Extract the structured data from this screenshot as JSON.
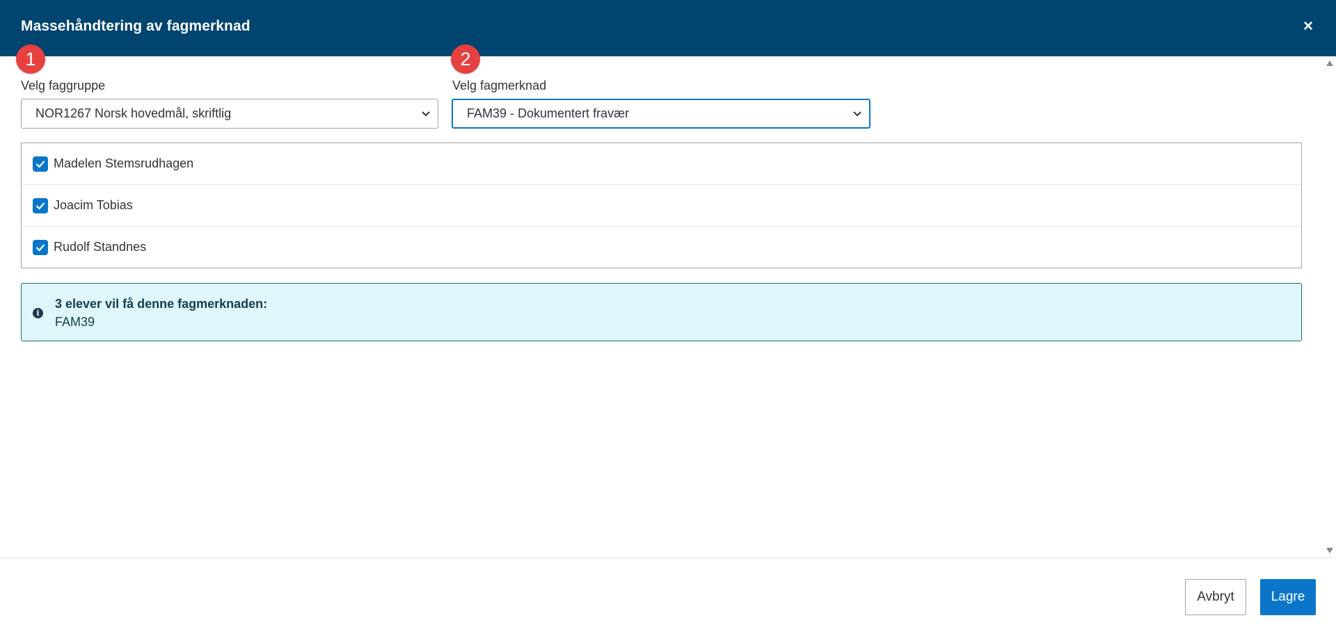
{
  "dialog": {
    "title": "Massehåndtering av fagmerknad",
    "close_label": "×"
  },
  "steps": {
    "step1": "1",
    "step2": "2"
  },
  "form": {
    "faggruppe_label": "Velg faggruppe",
    "faggruppe_selected": "NOR1267 Norsk hovedmål, skriftlig",
    "fagmerknad_label": "Velg fagmerknad",
    "fagmerknad_selected": "FAM39 - Dokumentert fravær"
  },
  "students": [
    {
      "name": "Madelen Stemsrudhagen",
      "checked": true
    },
    {
      "name": "Joacim Tobias",
      "checked": true
    },
    {
      "name": "Rudolf Standnes",
      "checked": true
    }
  ],
  "info": {
    "icon": "info-icon",
    "title": "3 elever vil få denne fagmerknaden:",
    "code": "FAM39"
  },
  "footer": {
    "cancel_label": "Avbryt",
    "save_label": "Lagre"
  },
  "colors": {
    "header_bg": "#004470",
    "primary": "#0a76c9",
    "marker": "#e74040",
    "info_bg": "#dff6fb"
  }
}
